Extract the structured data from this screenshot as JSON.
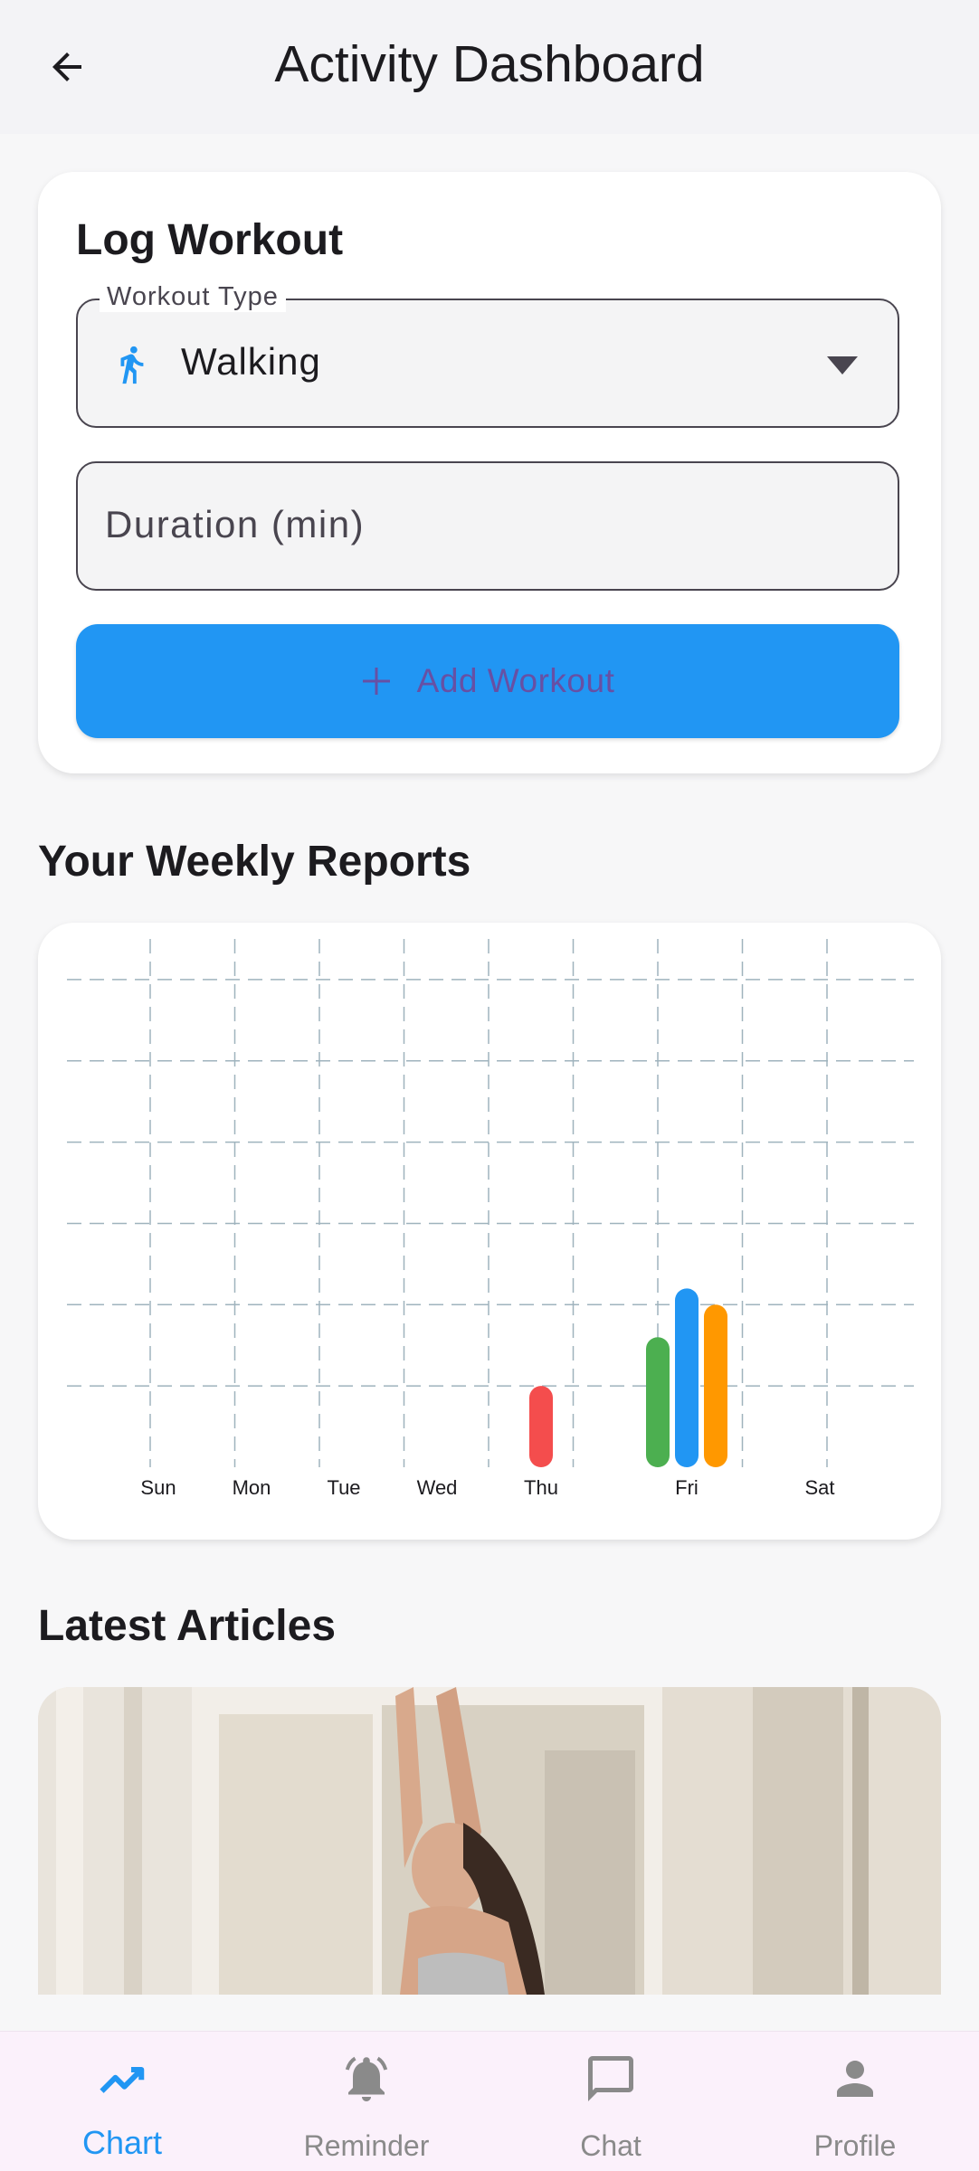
{
  "header": {
    "title": "Activity Dashboard",
    "back_icon": "arrow-left-icon"
  },
  "log_workout": {
    "title": "Log Workout",
    "workout_type": {
      "label": "Workout Type",
      "value": "Walking",
      "icon": "walking-icon"
    },
    "duration": {
      "placeholder": "Duration (min)",
      "value": ""
    },
    "add_button": {
      "label": "Add Workout",
      "icon": "plus-icon"
    }
  },
  "weekly_reports": {
    "title": "Your Weekly Reports"
  },
  "chart_data": {
    "type": "bar",
    "categories": [
      "Sun",
      "Mon",
      "Tue",
      "Wed",
      "Thu",
      "Fri",
      "Sat"
    ],
    "series": [
      {
        "color": "#f44d4d",
        "values": [
          0,
          0,
          0,
          0,
          1,
          0,
          0
        ]
      },
      {
        "color": "#4caf50",
        "values": [
          0,
          0,
          0,
          0,
          0,
          1.6,
          0
        ]
      },
      {
        "color": "#2196f3",
        "values": [
          0,
          0,
          0,
          0,
          0,
          2.2,
          0
        ]
      },
      {
        "color": "#ff9800",
        "values": [
          0,
          0,
          0,
          0,
          0,
          2.0,
          0
        ]
      }
    ],
    "ylim": [
      0,
      6.5
    ],
    "grid": true,
    "legend": "none"
  },
  "articles": {
    "title": "Latest Articles"
  },
  "nav": {
    "items": [
      {
        "label": "Chart",
        "icon": "trending-up-icon",
        "active": true
      },
      {
        "label": "Reminder",
        "icon": "bell-icon",
        "active": false
      },
      {
        "label": "Chat",
        "icon": "chat-bubble-icon",
        "active": false
      },
      {
        "label": "Profile",
        "icon": "person-icon",
        "active": false
      }
    ]
  },
  "colors": {
    "accent": "#2196f3",
    "button_text": "#6750a4",
    "nav_background": "#fbf1fb"
  }
}
